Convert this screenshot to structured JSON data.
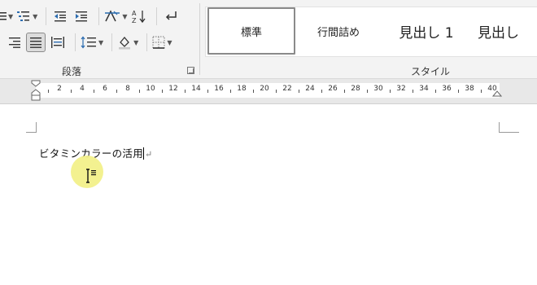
{
  "ribbon": {
    "paragraph_group_label": "段落",
    "styles_group_label": "スタイル",
    "styles": [
      {
        "label": "標準",
        "selected": true
      },
      {
        "label": "行間詰め",
        "selected": false
      },
      {
        "label": "見出し 1",
        "selected": false
      },
      {
        "label": "見出し",
        "selected": false
      }
    ]
  },
  "ruler": {
    "ticks": [
      "2",
      "4",
      "6",
      "8",
      "10",
      "12",
      "14",
      "16",
      "18",
      "20",
      "22",
      "24",
      "26",
      "28",
      "30",
      "32",
      "34",
      "36",
      "38",
      "40"
    ]
  },
  "document": {
    "text": "ビタミンカラーの活用",
    "paragraph_mark": "↵"
  },
  "colors": {
    "highlight": "#f2f08a",
    "ribbon_bg": "#f3f3f3",
    "ruler_bg": "#e8e8e8"
  },
  "icons": [
    "bullets-icon",
    "multilevel-list-icon",
    "decrease-indent-icon",
    "increase-indent-icon",
    "asian-layout-icon",
    "sort-icon",
    "show-formatting-icon",
    "align-right-icon",
    "justify-icon",
    "distributed-icon",
    "line-spacing-icon",
    "shading-icon",
    "borders-icon"
  ]
}
